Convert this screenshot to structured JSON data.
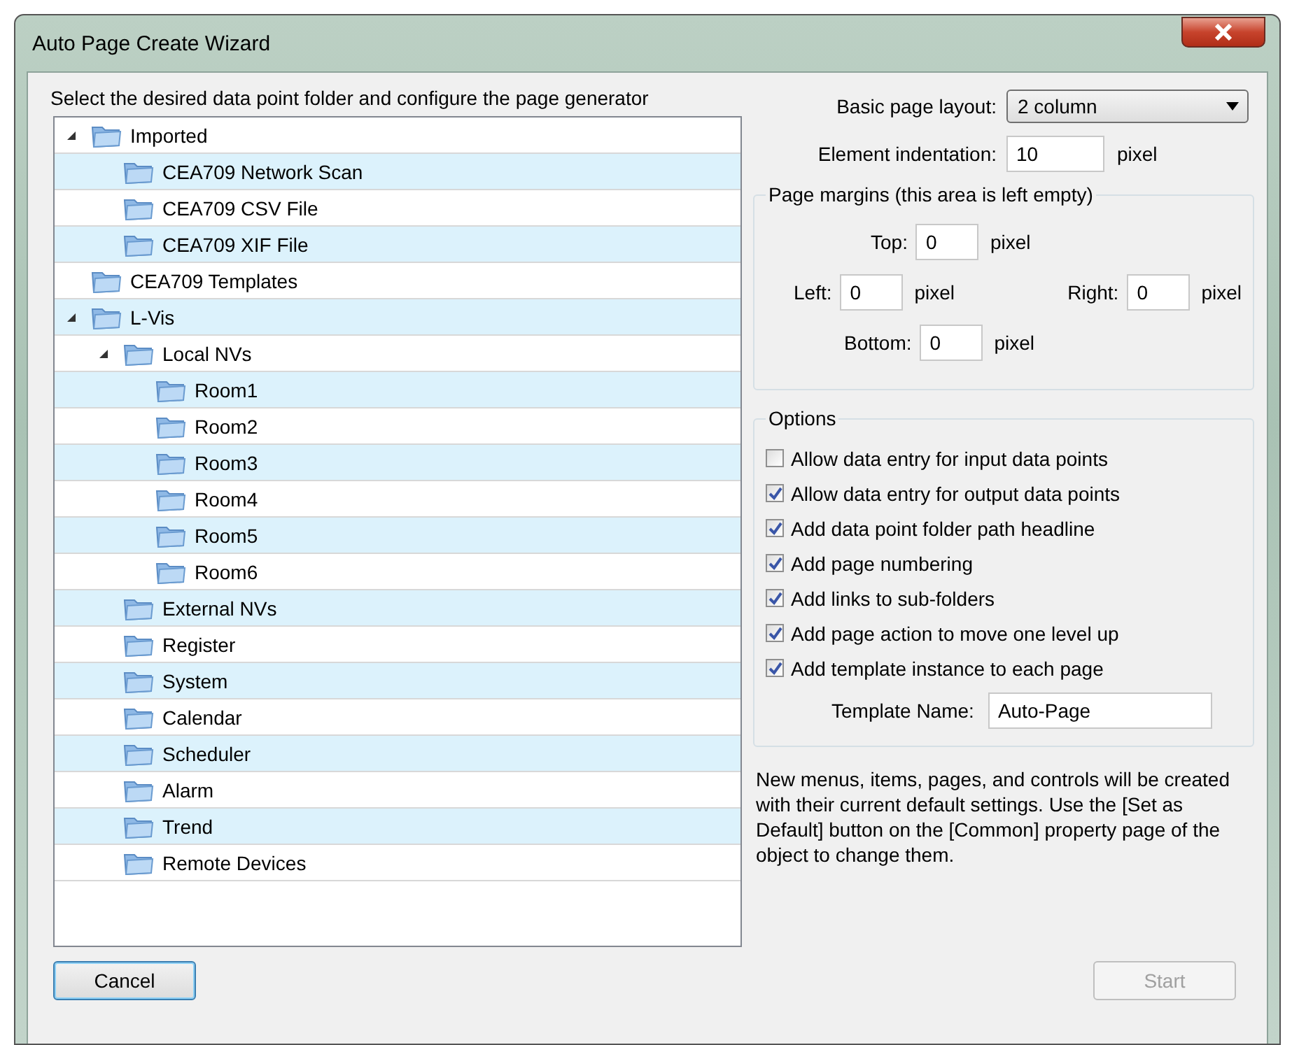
{
  "window": {
    "title": "Auto Page Create Wizard"
  },
  "instruction": "Select the desired data point folder and configure the page generator",
  "tree": [
    {
      "label": "Imported",
      "expanded": true,
      "children": [
        {
          "label": "CEA709 Network Scan"
        },
        {
          "label": "CEA709 CSV File"
        },
        {
          "label": "CEA709 XIF File"
        }
      ]
    },
    {
      "label": "CEA709 Templates"
    },
    {
      "label": "L-Vis",
      "expanded": true,
      "children": [
        {
          "label": "Local NVs",
          "expanded": true,
          "children": [
            {
              "label": "Room1"
            },
            {
              "label": "Room2"
            },
            {
              "label": "Room3"
            },
            {
              "label": "Room4"
            },
            {
              "label": "Room5"
            },
            {
              "label": "Room6"
            }
          ]
        },
        {
          "label": "External NVs"
        },
        {
          "label": "Register"
        },
        {
          "label": "System"
        },
        {
          "label": "Calendar"
        },
        {
          "label": "Scheduler"
        },
        {
          "label": "Alarm"
        },
        {
          "label": "Trend"
        },
        {
          "label": "Remote Devices"
        }
      ]
    }
  ],
  "layout": {
    "label": "Basic page layout:",
    "value": "2 column"
  },
  "indentation": {
    "label": "Element indentation:",
    "value": "10",
    "unit": "pixel"
  },
  "margins": {
    "title": "Page margins (this area is left empty)",
    "top": {
      "label": "Top:",
      "value": "0",
      "unit": "pixel"
    },
    "left": {
      "label": "Left:",
      "value": "0",
      "unit": "pixel"
    },
    "right": {
      "label": "Right:",
      "value": "0",
      "unit": "pixel"
    },
    "bottom": {
      "label": "Bottom:",
      "value": "0",
      "unit": "pixel"
    }
  },
  "options": {
    "title": "Options",
    "items": [
      {
        "label": "Allow data entry for input data points",
        "checked": false
      },
      {
        "label": "Allow data entry for output data points",
        "checked": true
      },
      {
        "label": "Add data point folder path headline",
        "checked": true
      },
      {
        "label": "Add page numbering",
        "checked": true
      },
      {
        "label": "Add links to sub-folders",
        "checked": true
      },
      {
        "label": "Add page action to move one level up",
        "checked": true
      },
      {
        "label": "Add template instance to each page",
        "checked": true
      }
    ],
    "template_name": {
      "label": "Template Name:",
      "value": "Auto-Page"
    }
  },
  "note": "New menus, items, pages, and controls will be created with their current default settings. Use the [Set as Default] button on the [Common] property page of the object to change them.",
  "buttons": [
    {
      "label": "Cancel",
      "disabled": false
    },
    {
      "label": "Start",
      "disabled": true
    }
  ]
}
